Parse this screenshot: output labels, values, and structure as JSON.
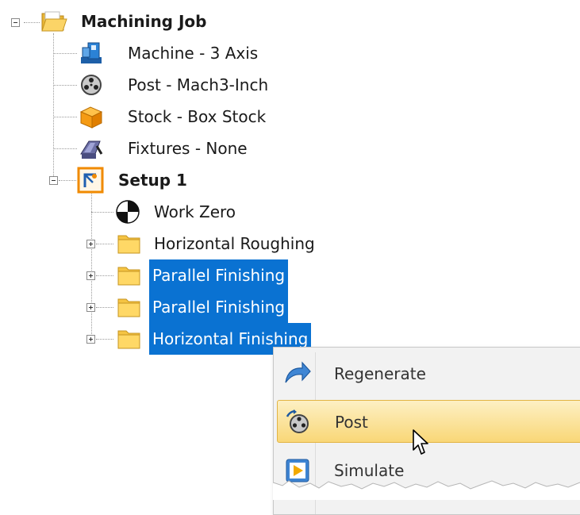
{
  "tree": {
    "root": {
      "label": "Machining Job",
      "expanded": true,
      "icon": "folder-open-icon"
    },
    "children": [
      {
        "label": "Machine - 3 Axis",
        "icon": "machine-icon"
      },
      {
        "label": "Post - Mach3-Inch",
        "icon": "post-reel-icon"
      },
      {
        "label": "Stock - Box Stock",
        "icon": "stock-box-icon"
      },
      {
        "label": "Fixtures - None",
        "icon": "fixture-vise-icon"
      }
    ],
    "setup": {
      "label": "Setup 1",
      "expanded": true,
      "icon": "setup-icon",
      "children": [
        {
          "label": "Work Zero",
          "icon": "work-zero-icon",
          "selected": false
        },
        {
          "label": "Horizontal Roughing",
          "icon": "folder-icon",
          "selected": false
        },
        {
          "label": "Parallel Finishing",
          "icon": "folder-icon",
          "selected": true
        },
        {
          "label": "Parallel Finishing",
          "icon": "folder-icon",
          "selected": true
        },
        {
          "label": "Horizontal Finishing",
          "icon": "folder-icon",
          "selected": true
        }
      ]
    }
  },
  "context_menu": {
    "items": [
      {
        "label": "Regenerate",
        "icon": "regenerate-arrow-icon",
        "highlighted": false
      },
      {
        "label": "Post",
        "icon": "post-reel-icon",
        "highlighted": true
      },
      {
        "label": "Simulate",
        "icon": "simulate-play-icon",
        "highlighted": false
      }
    ]
  },
  "colors": {
    "selection": "#0a72d2",
    "menu_highlight": "#f9d777",
    "menu_background": "#f2f2f2"
  }
}
